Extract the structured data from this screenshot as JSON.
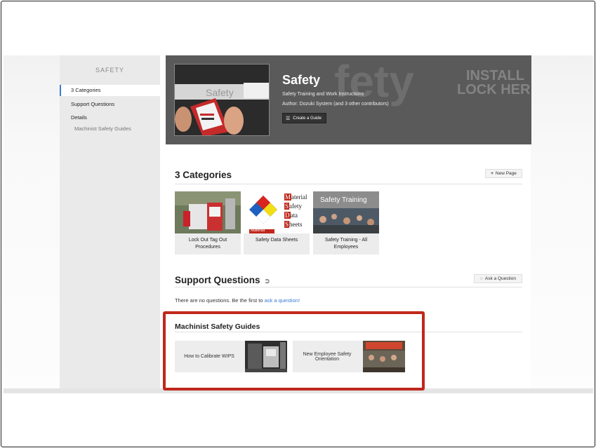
{
  "sidebar": {
    "title": "SAFETY",
    "items": [
      {
        "label": "3 Categories",
        "active": true
      },
      {
        "label": "Support Questions"
      },
      {
        "label": "Details"
      }
    ],
    "sub_item": "Machinist Safety Guides"
  },
  "hero": {
    "title": "Safety",
    "subtitle": "Safety Training and Work Instructions",
    "author": "Author: Dozuki System (and 3 other contributors)",
    "create_button": "Create a Guide",
    "thumb_text": "Safety",
    "bg_text_1": "fety",
    "bg_text_2": "INSTALL",
    "bg_text_3": "LOCK HER"
  },
  "categories": {
    "title": "3 Categories",
    "new_page_button": "New Page",
    "items": [
      {
        "label": "Lock Out Tag Out Procedures"
      },
      {
        "label": "Safety Data Sheets"
      },
      {
        "label": "Safety Training - All Employees"
      }
    ],
    "msds_letters": [
      "M",
      "S",
      "D",
      "S"
    ],
    "msds_rest": [
      "aterial",
      "afety",
      "ata",
      "heets"
    ],
    "msds_footer": "Material",
    "training_img_text": "Safety Training"
  },
  "support": {
    "title": "Support Questions",
    "ask_button": "Ask a Question",
    "empty_text": "There are no questions. Be the first to ",
    "ask_link": "ask a question!"
  },
  "guides": {
    "title": "Machinist Safety Guides",
    "items": [
      {
        "label": "How to Calibrate WIPS"
      },
      {
        "label": "New Employee Safety Orientation"
      }
    ]
  },
  "colors": {
    "accent": "#3a7bd5",
    "highlight": "#c0281c",
    "hero_bg": "#5a5a5a"
  }
}
